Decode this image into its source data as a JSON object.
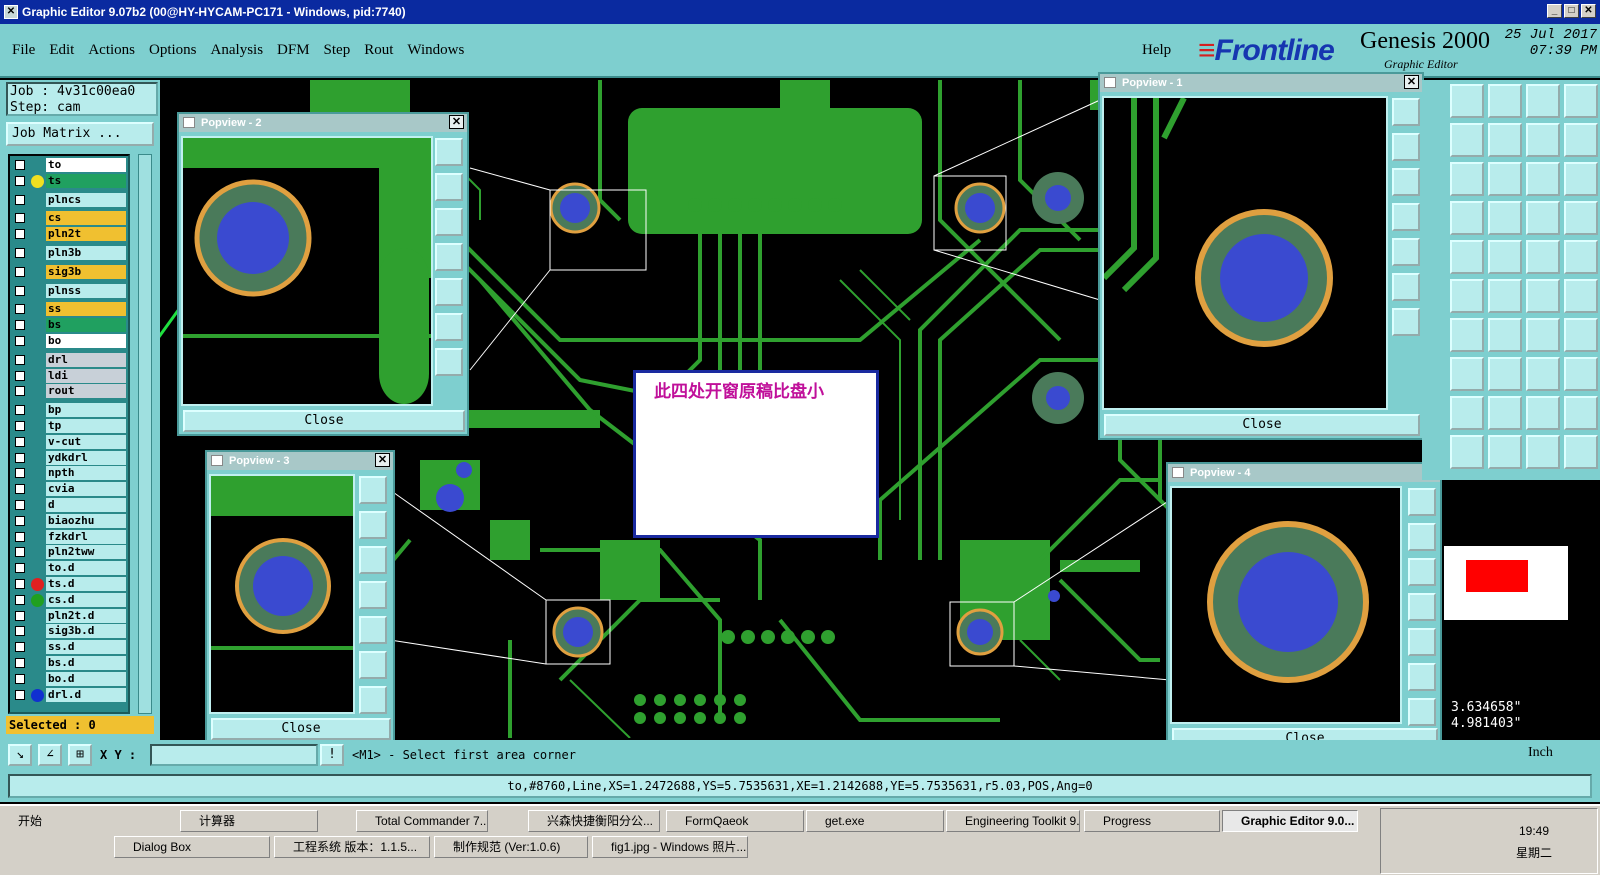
{
  "window": {
    "title": "Graphic Editor 9.07b2 (00@HY-HYCAM-PC171 - Windows, pid:7740)"
  },
  "menu": [
    "File",
    "Edit",
    "Actions",
    "Options",
    "Analysis",
    "DFM",
    "Step",
    "Rout",
    "Windows"
  ],
  "help": "Help",
  "brand": {
    "logo": "Frontline",
    "product": "Genesis 2000",
    "subtitle": "Graphic Editor",
    "date": "25 Jul 2017",
    "time": "07:39 PM"
  },
  "job": {
    "job_line": "Job : 4v31c00ea0",
    "step_line": "Step: cam",
    "matrix_button": "Job Matrix ..."
  },
  "layers": [
    {
      "name": "to",
      "bg": "#ffffff",
      "dot": ""
    },
    {
      "name": "ts",
      "bg": "#20a060",
      "dot": "#f0e020"
    },
    {
      "name": "plncs",
      "bg": "#b8ecec",
      "dot": ""
    },
    {
      "name": "cs",
      "bg": "#f0c030",
      "dot": ""
    },
    {
      "name": "pln2t",
      "bg": "#f0c030",
      "dot": ""
    },
    {
      "name": "pln3b",
      "bg": "#b8ecec",
      "dot": ""
    },
    {
      "name": "sig3b",
      "bg": "#f0c030",
      "dot": ""
    },
    {
      "name": "plnss",
      "bg": "#b8ecec",
      "dot": ""
    },
    {
      "name": "ss",
      "bg": "#f0c030",
      "dot": ""
    },
    {
      "name": "bs",
      "bg": "#20a060",
      "dot": ""
    },
    {
      "name": "bo",
      "bg": "#ffffff",
      "dot": ""
    },
    {
      "name": "drl",
      "bg": "#c8d0d8",
      "dot": ""
    },
    {
      "name": "ldi",
      "bg": "#c8d0d8",
      "dot": ""
    },
    {
      "name": "rout",
      "bg": "#c8d0d8",
      "dot": ""
    },
    {
      "name": "bp",
      "bg": "#b8ecec",
      "dot": ""
    },
    {
      "name": "tp",
      "bg": "#b8ecec",
      "dot": ""
    },
    {
      "name": "v-cut",
      "bg": "#b8ecec",
      "dot": ""
    },
    {
      "name": "ydkdrl",
      "bg": "#b8ecec",
      "dot": ""
    },
    {
      "name": "npth",
      "bg": "#b8ecec",
      "dot": ""
    },
    {
      "name": "cvia",
      "bg": "#b8ecec",
      "dot": ""
    },
    {
      "name": "d",
      "bg": "#b8ecec",
      "dot": ""
    },
    {
      "name": "biaozhu",
      "bg": "#b8ecec",
      "dot": ""
    },
    {
      "name": "fzkdrl",
      "bg": "#b8ecec",
      "dot": ""
    },
    {
      "name": "pln2tww",
      "bg": "#b8ecec",
      "dot": ""
    },
    {
      "name": "to.d",
      "bg": "#b8ecec",
      "dot": ""
    },
    {
      "name": "ts.d",
      "bg": "#b8ecec",
      "dot": "#e02020"
    },
    {
      "name": "cs.d",
      "bg": "#b8ecec",
      "dot": "#20a020"
    },
    {
      "name": "pln2t.d",
      "bg": "#b8ecec",
      "dot": ""
    },
    {
      "name": "sig3b.d",
      "bg": "#b8ecec",
      "dot": ""
    },
    {
      "name": "ss.d",
      "bg": "#b8ecec",
      "dot": ""
    },
    {
      "name": "bs.d",
      "bg": "#b8ecec",
      "dot": ""
    },
    {
      "name": "bo.d",
      "bg": "#b8ecec",
      "dot": ""
    },
    {
      "name": "drl.d",
      "bg": "#b8ecec",
      "dot": "#1030d0"
    }
  ],
  "selected": "Selected : 0",
  "popups": [
    {
      "title": "Popview - 2",
      "close": "Close"
    },
    {
      "title": "Popview - 3",
      "close": "Close"
    },
    {
      "title": "Popview - 1",
      "close": "Close"
    },
    {
      "title": "Popview - 4",
      "close": "Close"
    }
  ],
  "note": "此四处开窗原稿比盘小",
  "coords": {
    "x": "3.634658\"",
    "y": "4.981403\""
  },
  "bottom": {
    "xy_label": "X Y :",
    "prompt": "<M1> - Select first area corner",
    "units": "Inch"
  },
  "status": "to,#8760,Line,XS=1.2472688,YS=5.7535631,XE=1.2142688,YE=5.7535631,r5.03,POS,Ang=0",
  "taskbar": {
    "start": "开始",
    "row1": [
      "计算器",
      "Total Commander 7....",
      "兴森快捷衡阳分公...",
      "FormQaeok",
      "get.exe",
      "Engineering Toolkit 9....",
      "Progress",
      "Graphic Editor 9.0..."
    ],
    "row2": [
      "Dialog Box",
      "工程系统  版本：1.1.5...",
      "制作规范 (Ver:1.0.6)",
      "fig1.jpg - Windows 照片..."
    ],
    "time": "19:49",
    "day": "星期二"
  },
  "colors": {
    "pcb_trace": "#2fa02f",
    "pad_copper": "#4a7a5a",
    "pad_hole": "#3a4ad0",
    "pad_ring": "#e0a040",
    "panel": "#7ecfcf",
    "titlebar": "#0a2aa0"
  }
}
